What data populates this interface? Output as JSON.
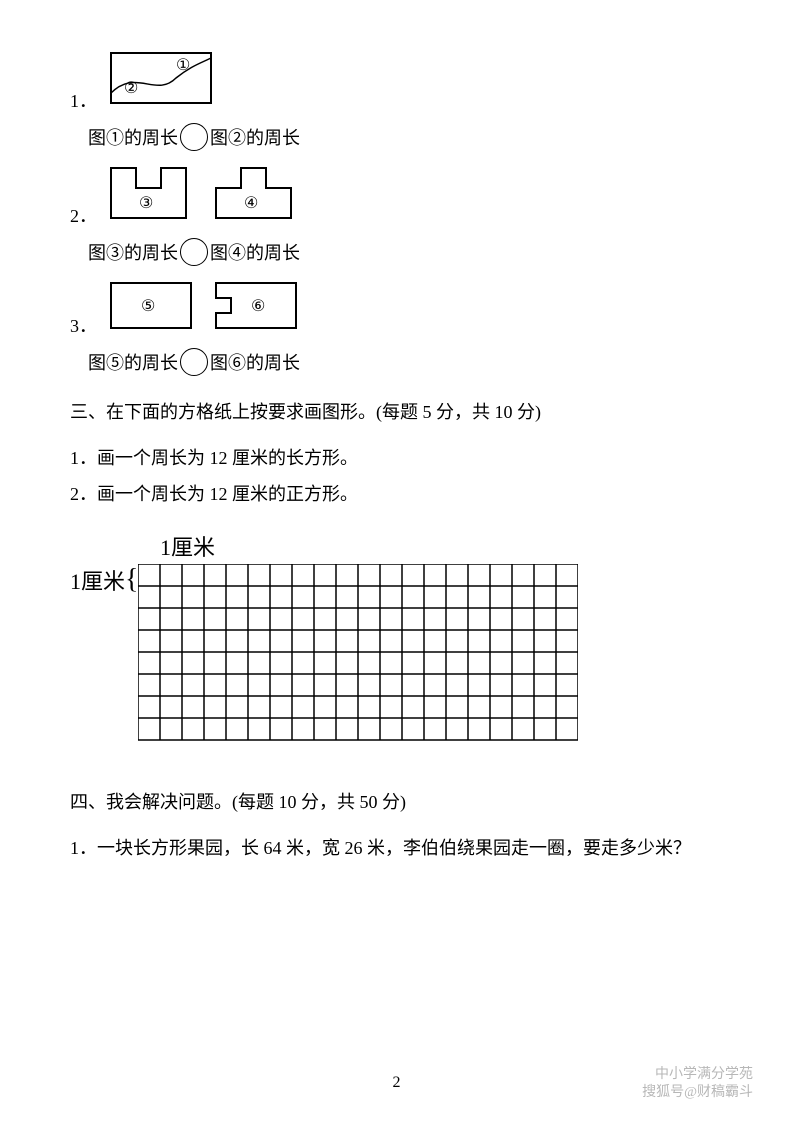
{
  "q1": {
    "num": "1．",
    "label_1": "①",
    "label_2": "②",
    "text_a": "图①的周长",
    "text_b": "图②的周长"
  },
  "q2": {
    "num": "2．",
    "label_3": "③",
    "label_4": "④",
    "text_a": "图③的周长",
    "text_b": "图④的周长"
  },
  "q3": {
    "num": "3．",
    "label_5": "⑤",
    "label_6": "⑥",
    "text_a": "图⑤的周长",
    "text_b": "图⑥的周长"
  },
  "section3": {
    "title": "三、在下面的方格纸上按要求画图形。(每题 5 分，共 10 分)",
    "p1": "1．画一个周长为 12 厘米的长方形。",
    "p2": "2．画一个周长为 12 厘米的正方形。",
    "unit_top": "1厘米",
    "unit_left": "1厘米"
  },
  "section4": {
    "title": "四、我会解决问题。(每题 10 分，共 50 分)",
    "p1": "1．一块长方形果园，长 64 米，宽 26 米，李伯伯绕果园走一圈，要走多少米？"
  },
  "page_number": "2",
  "watermark": {
    "line1": "中小学满分学苑",
    "line2": "搜狐号@财稿霸斗"
  },
  "chart_data": {
    "type": "table",
    "description": "grid paper",
    "cell_size_label": "1厘米",
    "columns": 20,
    "rows": 8
  }
}
